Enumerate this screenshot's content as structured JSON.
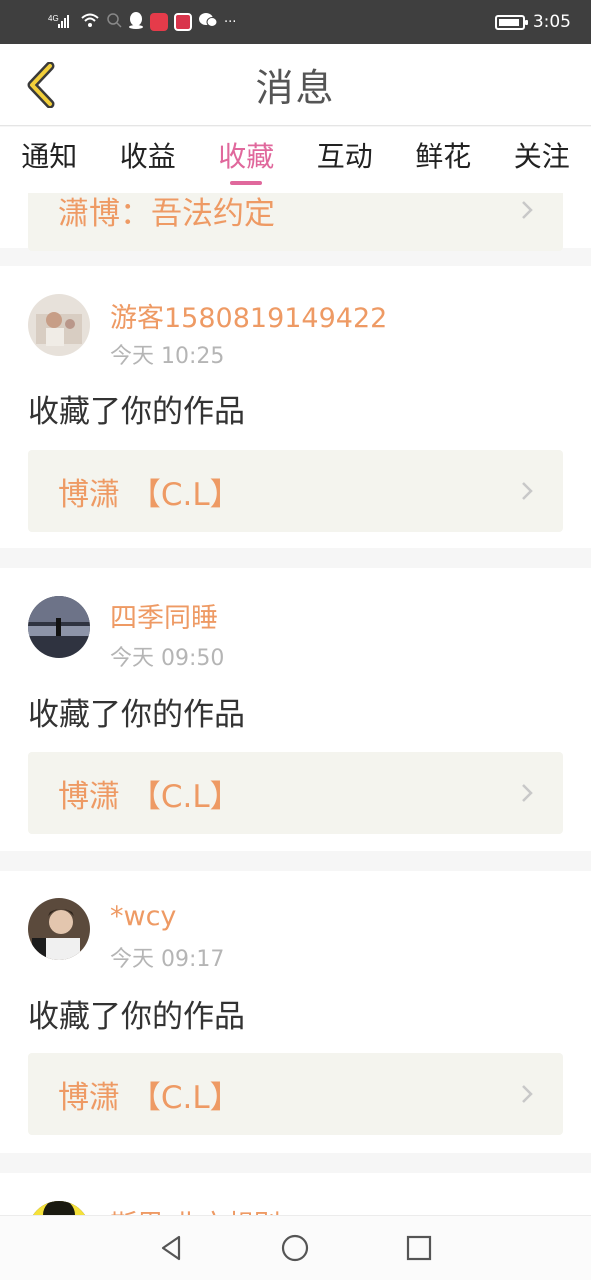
{
  "status_bar": {
    "signal_label": "4G",
    "time": "3:05",
    "more": "···",
    "icons": [
      "signal-icon",
      "wifi-icon",
      "search-icon",
      "qq-icon",
      "app-icon",
      "app-icon",
      "wechat-icon"
    ]
  },
  "header": {
    "title": "消息",
    "back_icon": "chevron-left-icon"
  },
  "tabs": [
    {
      "label": "通知",
      "active": false
    },
    {
      "label": "收益",
      "active": false
    },
    {
      "label": "收藏",
      "active": true
    },
    {
      "label": "互动",
      "active": false
    },
    {
      "label": "鲜花",
      "active": false
    },
    {
      "label": "关注",
      "active": false
    }
  ],
  "colors": {
    "accent": "#e0689c",
    "name": "#ee9a64",
    "work_bg": "#f4f4ee",
    "divider": "#f6f6f6"
  },
  "feed": {
    "partial_top_work": "潇博：吾法约定",
    "items": [
      {
        "username": "游客1580819149422",
        "time": "今天 10:25",
        "action": "收藏了你的作品",
        "work_title": "博潇 【C.L】"
      },
      {
        "username": "四季同睡",
        "time": "今天 09:50",
        "action": "收藏了你的作品",
        "work_title": "博潇 【C.L】"
      },
      {
        "username": "*wcy",
        "time": "今天 09:17",
        "action": "收藏了你的作品",
        "work_title": "博潇 【C.L】"
      }
    ],
    "partial_bottom_username": "斯思·北方想别"
  },
  "navbar": {
    "back": "triangle-back-icon",
    "home": "circle-home-icon",
    "recents": "square-recents-icon"
  }
}
